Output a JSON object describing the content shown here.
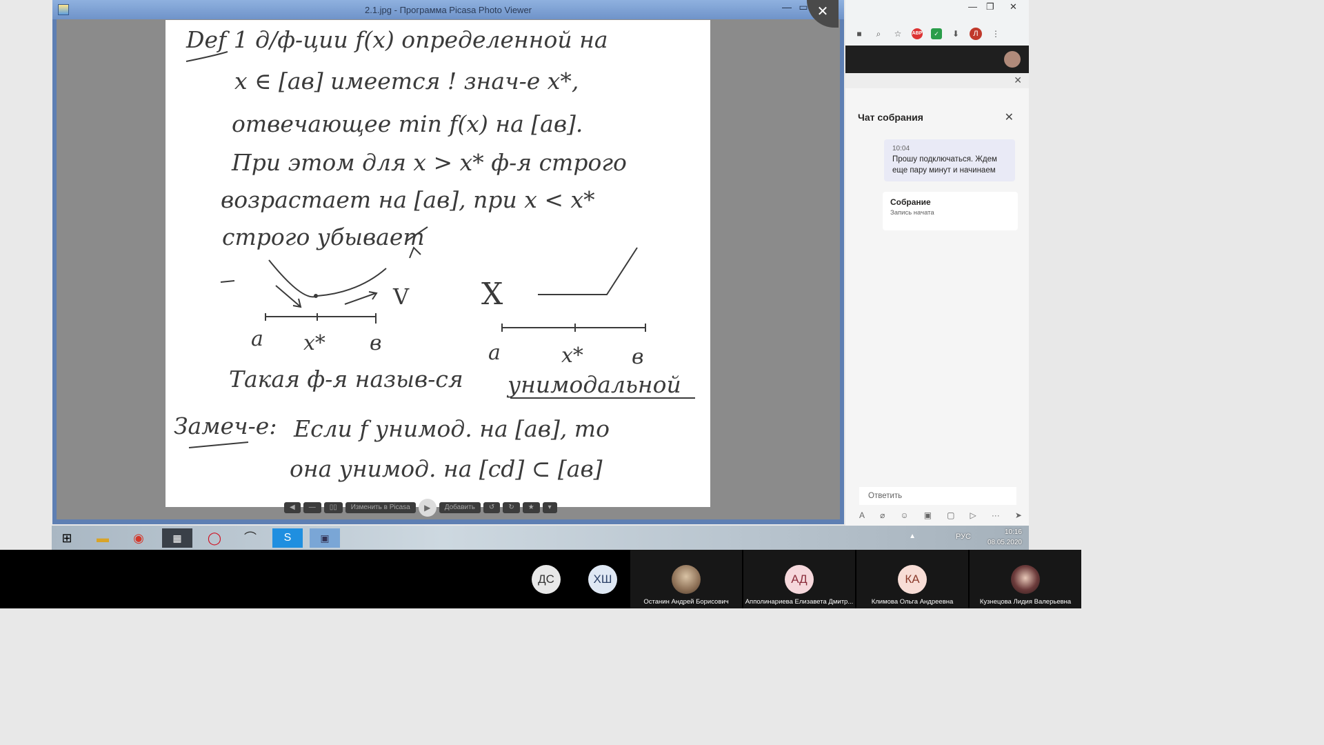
{
  "picasa": {
    "title": "2.1.jpg - Программа Picasa Photo Viewer",
    "close_overlay": "✕",
    "toolbar": {
      "edit_label": "Изменить в Picasa",
      "add_label": "Добавить"
    }
  },
  "photo": {
    "heading": "Def  1 д/ф-ции f(x) определенной на",
    "line2": "x ∈ [ав] имеется ! знач-е x*,",
    "line3": "отвечающее min f(x) на [ав].",
    "line4": "При этом для x > x* ф-я строго",
    "line5": "возрастает на [ав], при x < x*",
    "line6": "строго убывает",
    "label_a1": "a",
    "label_x1": "x*",
    "label_b1": "в",
    "check_mark": "V",
    "cross_mark": "X",
    "label_a2": "a",
    "label_x2": "x*",
    "label_b2": "в",
    "line7": "Такая ф-я назыв-ся",
    "line7_underlined": "унимодальной",
    "remark": "Замеч-е:",
    "line8": "Если f унимод. на [ав], то",
    "line9": "она унимод. на [cd] ⊂ [ав]"
  },
  "browser": {
    "minimize": "—",
    "restore": "❐",
    "close": "✕",
    "profile_initial": "Л"
  },
  "chat": {
    "title": "Чат собрания",
    "messages": [
      {
        "time": "10:04",
        "text": "Прошу подключаться. Ждем еще пару минут и начинаем"
      }
    ],
    "event": {
      "title": "Собрание",
      "subtitle": "Запись начата"
    },
    "reply_placeholder": "Ответить"
  },
  "taskbar": {
    "lang": "РУС",
    "time": "10:16",
    "date": "08.05.2020"
  },
  "participants": [
    {
      "initials": "ДС",
      "name": "",
      "bg": "#e8e8e8",
      "fg": "#333333"
    },
    {
      "initials": "ХШ",
      "name": "",
      "bg": "#dfe8f4",
      "fg": "#2a3f66"
    },
    {
      "initials": "",
      "name": "Останин Андрей Борисович",
      "bg": "",
      "fg": ""
    },
    {
      "initials": "АД",
      "name": "Апполинариева Елизавета Дмитр...",
      "bg": "#f6d8dc",
      "fg": "#8a2b3a"
    },
    {
      "initials": "КА",
      "name": "Климова Ольга Андреевна",
      "bg": "#f8ddd6",
      "fg": "#8a3a2b"
    },
    {
      "initials": "",
      "name": "Кузнецова Лидия Валерьевна",
      "bg": "",
      "fg": ""
    }
  ],
  "colors": {
    "picasa_frame": "#5e7fb3",
    "viewer_bg": "#8b8b8b",
    "ink": "#3a3a3a",
    "teams_msg_bg": "#e9eaf6"
  }
}
